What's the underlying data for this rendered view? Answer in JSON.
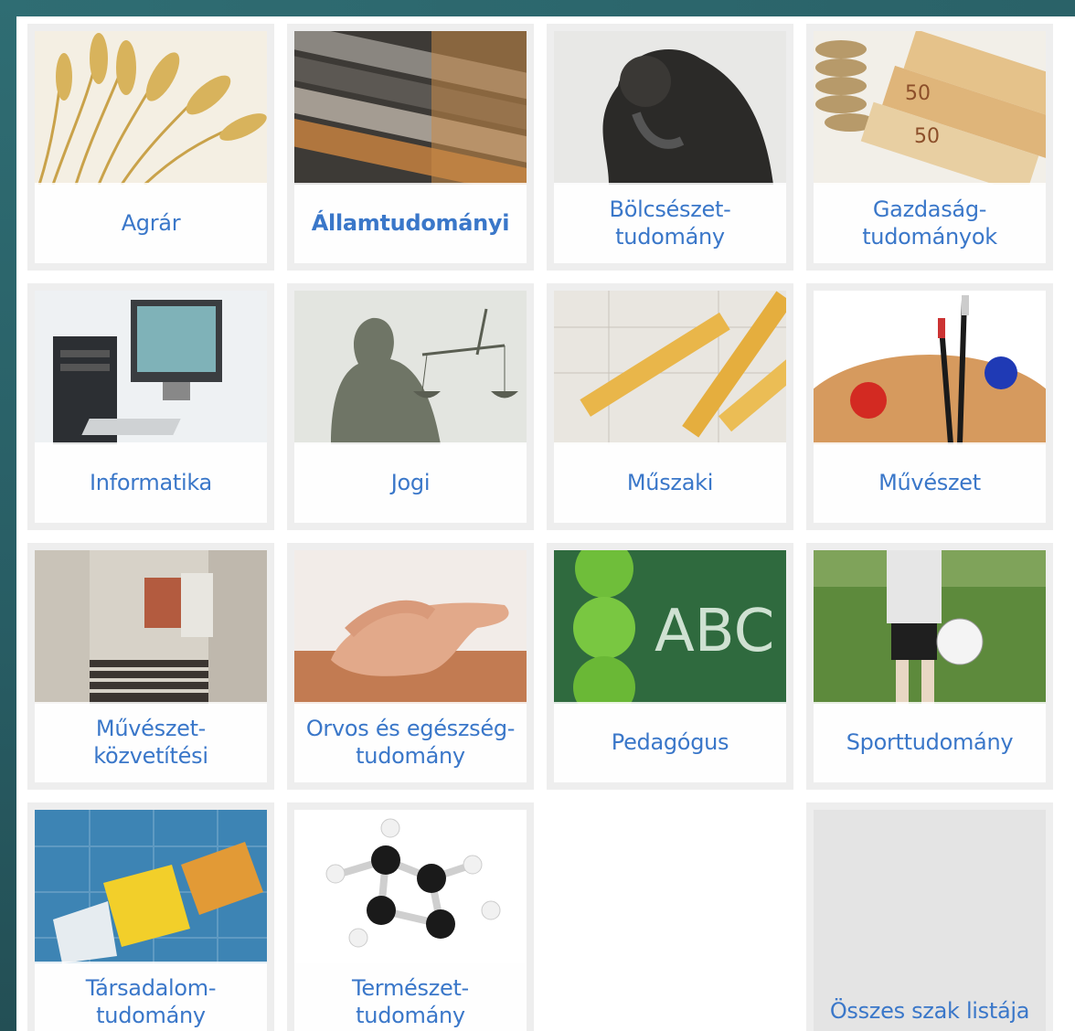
{
  "tiles": [
    {
      "label": "Agrár",
      "icon": "wheat-image"
    },
    {
      "label": "Államtudományi",
      "icon": "books-image"
    },
    {
      "label": "Bölcsészet-\ntudomány",
      "icon": "thinker-statue-image"
    },
    {
      "label": "Gazdaság-\ntudományok",
      "icon": "euro-money-image"
    },
    {
      "label": "Informatika",
      "icon": "computer-image"
    },
    {
      "label": "Jogi",
      "icon": "justice-statue-image"
    },
    {
      "label": "Műszaki",
      "icon": "ruler-image"
    },
    {
      "label": "Művészet",
      "icon": "paint-palette-image"
    },
    {
      "label": "Művészet-\nközvetítési",
      "icon": "gallery-image"
    },
    {
      "label": "Orvos és egészség-\ntudomány",
      "icon": "hands-image"
    },
    {
      "label": "Pedagógus",
      "icon": "chalkboard-apples-image"
    },
    {
      "label": "Sporttudomány",
      "icon": "football-player-image"
    },
    {
      "label": "Társadalom-\ntudomány",
      "icon": "puzzle-image"
    },
    {
      "label": "Természet-\ntudomány",
      "icon": "molecule-image"
    }
  ],
  "all_link": {
    "label": "Összes szak listája"
  },
  "colors": {
    "label": "#3a77c9",
    "frame": "#2f6d73",
    "tile_bg": "#eeeeee"
  }
}
